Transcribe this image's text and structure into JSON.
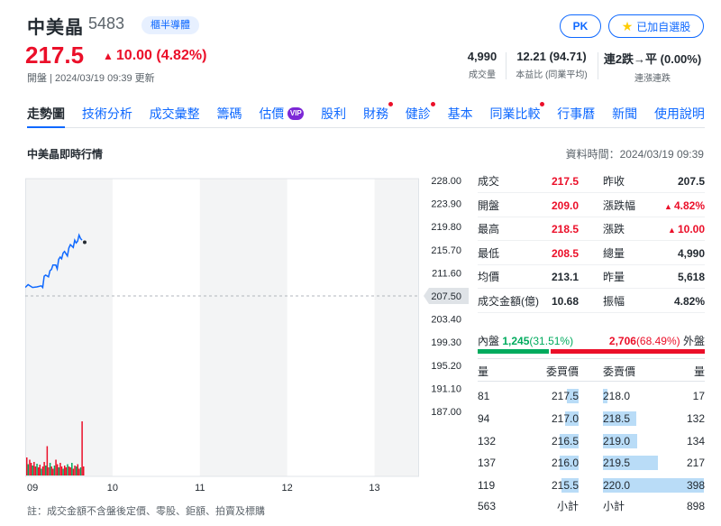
{
  "header": {
    "name": "中美晶",
    "code": "5483",
    "industry": "櫃半導體",
    "pk_label": "PK",
    "watch_label": "已加自選股",
    "price": "217.5",
    "change": "10.00 (4.82%)",
    "market_status": "開盤 | 2024/03/19 09:39 更新",
    "stats": [
      {
        "value": "4,990",
        "label": "成交量"
      },
      {
        "value": "12.21 (94.71)",
        "label": "本益比 (同業平均)"
      },
      {
        "value": "連2跌→平 (0.00%)",
        "label": "連漲連跌"
      }
    ]
  },
  "tabs": [
    {
      "label": "走勢圖",
      "active": true,
      "dot": false,
      "vip": false
    },
    {
      "label": "技術分析",
      "active": false,
      "dot": false,
      "vip": false
    },
    {
      "label": "成交彙整",
      "active": false,
      "dot": false,
      "vip": false
    },
    {
      "label": "籌碼",
      "active": false,
      "dot": false,
      "vip": false
    },
    {
      "label": "估價",
      "active": false,
      "dot": false,
      "vip": true
    },
    {
      "label": "股利",
      "active": false,
      "dot": false,
      "vip": false
    },
    {
      "label": "財務",
      "active": false,
      "dot": true,
      "vip": false
    },
    {
      "label": "健診",
      "active": false,
      "dot": true,
      "vip": false
    },
    {
      "label": "基本",
      "active": false,
      "dot": false,
      "vip": false
    },
    {
      "label": "同業比較",
      "active": false,
      "dot": true,
      "vip": false
    },
    {
      "label": "行事曆",
      "active": false,
      "dot": false,
      "vip": false
    },
    {
      "label": "新聞",
      "active": false,
      "dot": false,
      "vip": false
    },
    {
      "label": "使用說明",
      "active": false,
      "dot": false,
      "vip": false
    }
  ],
  "vip_label": "VIP",
  "section_title": "中美晶即時行情",
  "data_time": "資料時間：2024/03/19 09:39",
  "chart_data": {
    "type": "line",
    "y_ticks": [
      "228.00",
      "223.90",
      "219.80",
      "215.70",
      "211.60",
      "207.50",
      "203.40",
      "199.30",
      "195.20",
      "191.10",
      "187.00"
    ],
    "ylim": [
      187.0,
      228.0
    ],
    "reference_price": "207.50",
    "x_ticks": [
      "09",
      "10",
      "11",
      "12",
      "13"
    ],
    "xlim": [
      0,
      270
    ],
    "price_series": [
      [
        0,
        209.0
      ],
      [
        2,
        209.5
      ],
      [
        5,
        209.0
      ],
      [
        8,
        209.1
      ],
      [
        11,
        209.3
      ],
      [
        12,
        209.0
      ],
      [
        13,
        211.0
      ],
      [
        14,
        211.2
      ],
      [
        16,
        210.9
      ],
      [
        17,
        212.0
      ],
      [
        18,
        212.2
      ],
      [
        19,
        213.0
      ],
      [
        21,
        213.0
      ],
      [
        22,
        212.3
      ],
      [
        23,
        214.0
      ],
      [
        24,
        214.4
      ],
      [
        25,
        214.1
      ],
      [
        26,
        215.1
      ],
      [
        27,
        215.4
      ],
      [
        29,
        214.6
      ],
      [
        30,
        216.0
      ],
      [
        31,
        216.6
      ],
      [
        33,
        216.1
      ],
      [
        34,
        217.4
      ],
      [
        35,
        216.9
      ],
      [
        36,
        217.2
      ],
      [
        37,
        218.3
      ],
      [
        38,
        217.7
      ],
      [
        39,
        217.4
      ]
    ],
    "last_point": [
      39,
      217.5
    ],
    "volume_series": [
      40,
      25,
      35,
      28,
      22,
      30,
      20,
      26,
      18,
      24,
      15,
      20,
      30,
      22,
      65,
      18,
      28,
      20,
      15,
      22,
      35,
      25,
      18,
      28,
      20,
      15,
      22,
      18,
      25,
      20,
      18,
      28,
      15,
      22,
      20,
      25,
      15,
      18,
      120,
      20
    ],
    "colors": {
      "line": "#0f69ff",
      "up": "#eb0f29",
      "down": "#00ab5e",
      "shade": "#f3f4f5"
    }
  },
  "quote": [
    {
      "l1": "成交",
      "v1": "217.5",
      "c1": "red",
      "l2": "昨收",
      "v2": "207.5",
      "c2": ""
    },
    {
      "l1": "開盤",
      "v1": "209.0",
      "c1": "red",
      "l2": "漲跌幅",
      "v2": "4.82%",
      "c2": "red",
      "arrow2": true
    },
    {
      "l1": "最高",
      "v1": "218.5",
      "c1": "red",
      "l2": "漲跌",
      "v2": "10.00",
      "c2": "red",
      "arrow2": true
    },
    {
      "l1": "最低",
      "v1": "208.5",
      "c1": "red",
      "l2": "總量",
      "v2": "4,990",
      "c2": ""
    },
    {
      "l1": "均價",
      "v1": "213.1",
      "c1": "",
      "l2": "昨量",
      "v2": "5,618",
      "c2": ""
    },
    {
      "l1": "成交金額(億)",
      "v1": "10.68",
      "c1": "",
      "l2": "振幅",
      "v2": "4.82%",
      "c2": ""
    }
  ],
  "inout": {
    "in_label": "內盤",
    "in_value": "1,245",
    "in_pct": "(31.51%)",
    "out_value": "2,706",
    "out_pct": "(68.49%)",
    "out_label": "外盤",
    "in_fraction": 0.3151
  },
  "orderbook": {
    "headers": {
      "bid_vol": "量",
      "bid_price": "委買價",
      "ask_price": "委賣價",
      "ask_vol": "量"
    },
    "rows": [
      {
        "bid_vol": "81",
        "bid_price": "217.5",
        "ask_price": "218.0",
        "ask_vol": "17",
        "bid_n": 81,
        "ask_n": 17
      },
      {
        "bid_vol": "94",
        "bid_price": "217.0",
        "ask_price": "218.5",
        "ask_vol": "132",
        "bid_n": 94,
        "ask_n": 132
      },
      {
        "bid_vol": "132",
        "bid_price": "216.5",
        "ask_price": "219.0",
        "ask_vol": "134",
        "bid_n": 132,
        "ask_n": 134
      },
      {
        "bid_vol": "137",
        "bid_price": "216.0",
        "ask_price": "219.5",
        "ask_vol": "217",
        "bid_n": 137,
        "ask_n": 217
      },
      {
        "bid_vol": "119",
        "bid_price": "215.5",
        "ask_price": "220.0",
        "ask_vol": "398",
        "bid_n": 119,
        "ask_n": 398
      }
    ],
    "subtotal_bid": "563",
    "subtotal_label": "小計",
    "subtotal_ask": "898"
  },
  "footnote": "註：成交金額不含盤後定價、零股、鉅額、拍賣及標購"
}
